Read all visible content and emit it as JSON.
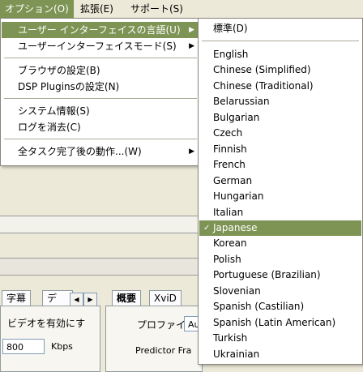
{
  "menubar": {
    "items": [
      {
        "label": "オプション(O)"
      },
      {
        "label": "拡張(E)"
      },
      {
        "label": "サポート(S)"
      }
    ]
  },
  "options_menu": {
    "items": [
      {
        "label": "ユーザー インターフェイスの言語(U)",
        "has_submenu": true
      },
      {
        "label": "ユーザーインターフェイスモード(S)",
        "has_submenu": true
      },
      {
        "label": "ブラウザの設定(B)"
      },
      {
        "label": "DSP Pluginsの設定(N)"
      },
      {
        "label": "システム情報(S)"
      },
      {
        "label": "ログを消去(C)"
      },
      {
        "label": "全タスク完了後の動作...(W)",
        "has_submenu": true
      }
    ]
  },
  "language_menu": {
    "default_label": "標準(D)",
    "languages": [
      "English",
      "Chinese (Simplified)",
      "Chinese (Traditional)",
      "Belarussian",
      "Bulgarian",
      "Czech",
      "Finnish",
      "French",
      "German",
      "Hungarian",
      "Italian",
      "Japanese",
      "Korean",
      "Polish",
      "Portuguese (Brazilian)",
      "Slovenian",
      "Spanish (Castilian)",
      "Spanish (Latin American)",
      "Turkish",
      "Ukrainian"
    ],
    "selected": "Japanese",
    "check_glyph": "✓"
  },
  "background": {
    "tabs_left": [
      "字幕",
      "デ"
    ],
    "tabs_right": [
      "概要",
      "XviD"
    ],
    "video_enable_text": "ビデオを有効にす",
    "bitrate_value": "800",
    "bitrate_unit": "Kbps",
    "profile_label": "プロファイ",
    "profile_value": "Au",
    "predictor_label": "Predictor Fra"
  },
  "colors": {
    "highlight": "#7d9454",
    "menu_bg": "#ffffff",
    "window_bg": "#ece9d8"
  }
}
